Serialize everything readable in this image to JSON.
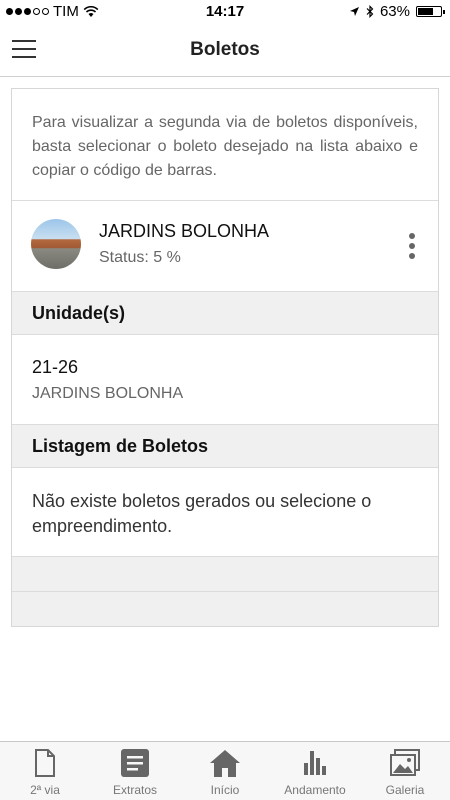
{
  "status_bar": {
    "carrier": "TIM",
    "time": "14:17",
    "battery": "63%"
  },
  "header": {
    "title": "Boletos"
  },
  "intro_text": "Para visualizar a segunda via de boletos disponíveis, basta selecionar o boleto desejado na lista abaixo e copiar o código de barras.",
  "empreendimento": {
    "name": "JARDINS BOLONHA",
    "status": "Status: 5 %"
  },
  "units_section": {
    "title": "Unidade(s)",
    "code": "21-26",
    "name": "JARDINS BOLONHA"
  },
  "boletos_section": {
    "title": "Listagem de Boletos",
    "empty_message": "Não existe boletos gerados ou selecione o empreendimento."
  },
  "tabs": [
    {
      "label": "2ª via",
      "icon": "document-icon"
    },
    {
      "label": "Extratos",
      "icon": "list-icon"
    },
    {
      "label": "Início",
      "icon": "home-icon"
    },
    {
      "label": "Andamento",
      "icon": "bar-chart-icon"
    },
    {
      "label": "Galeria",
      "icon": "gallery-icon"
    }
  ]
}
